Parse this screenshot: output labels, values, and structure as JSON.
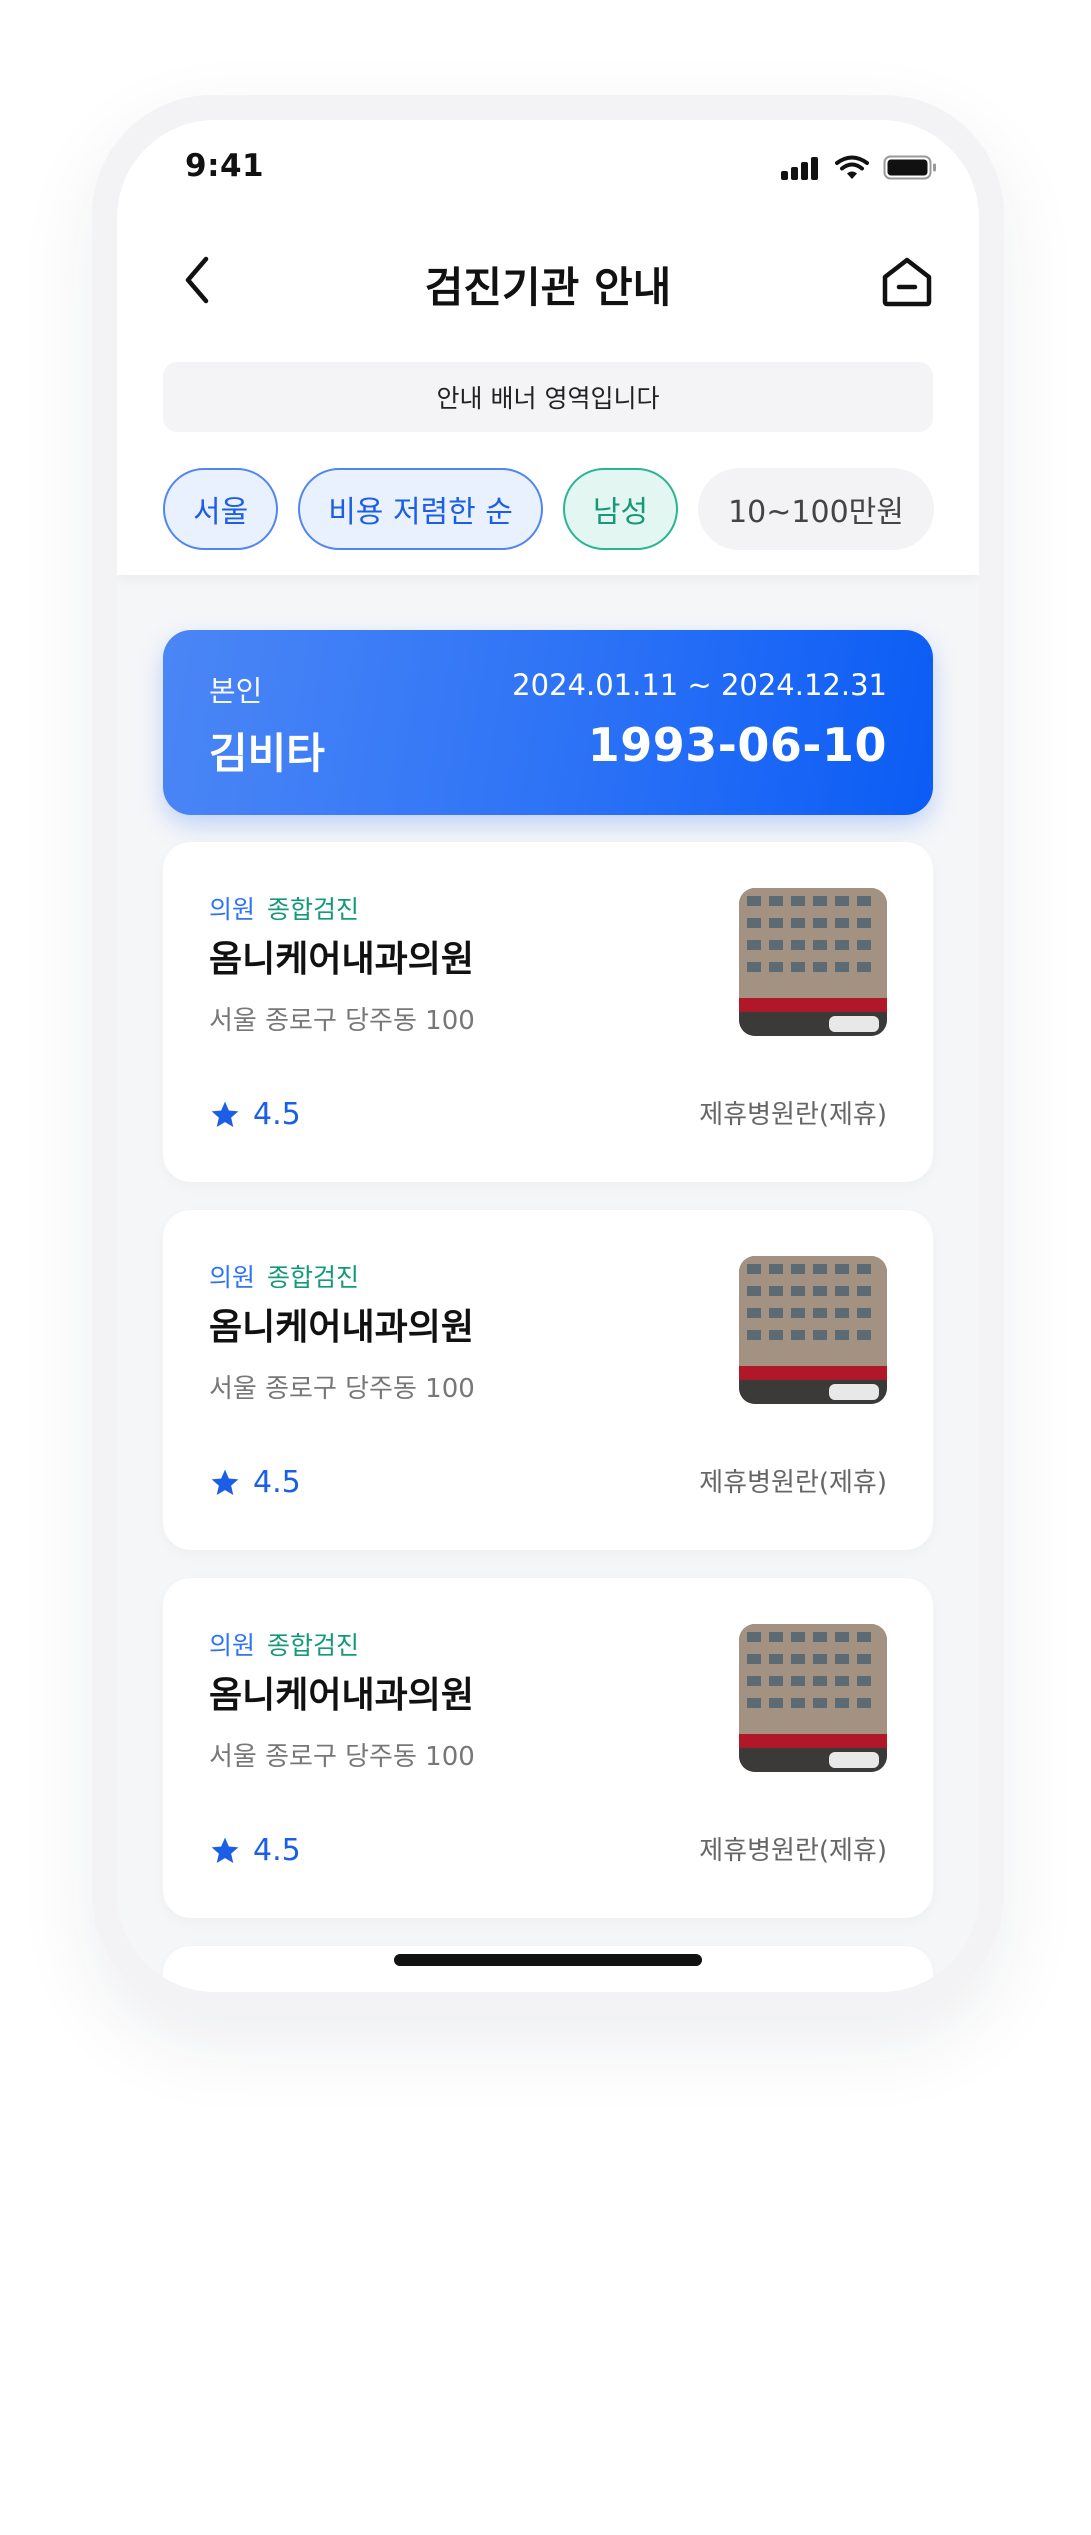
{
  "status_bar": {
    "time": "9:41"
  },
  "header": {
    "title": "검진기관 안내"
  },
  "banner": {
    "text": "안내 배너 영역입니다"
  },
  "filters": [
    {
      "label": "서울",
      "style": "blue"
    },
    {
      "label": "비용 저렴한 순",
      "style": "blue"
    },
    {
      "label": "남성",
      "style": "green"
    },
    {
      "label": "10~100만원",
      "style": "gray"
    }
  ],
  "profile": {
    "relation": "본인",
    "name": "김비타",
    "period": "2024.01.11 ~ 2024.12.31",
    "birth": "1993-06-10"
  },
  "hospitals": [
    {
      "type": "의원",
      "category": "종합검진",
      "name": "옴니케어내과의원",
      "address": "서울 종로구 당주동 100",
      "rating": "4.5",
      "partner": "제휴병원란(제휴)"
    },
    {
      "type": "의원",
      "category": "종합검진",
      "name": "옴니케어내과의원",
      "address": "서울 종로구 당주동 100",
      "rating": "4.5",
      "partner": "제휴병원란(제휴)"
    },
    {
      "type": "의원",
      "category": "종합검진",
      "name": "옴니케어내과의원",
      "address": "서울 종로구 당주동 100",
      "rating": "4.5",
      "partner": "제휴병원란(제휴)"
    }
  ],
  "icons": {
    "back": "chevron-left-icon",
    "home": "home-icon",
    "rating": "star-icon",
    "signal": "signal-icon",
    "wifi": "wifi-icon",
    "battery": "battery-icon"
  },
  "colors": {
    "accent": "#2f74f6",
    "green": "#14997a",
    "card_gradient_end": "#0b5cf5"
  }
}
